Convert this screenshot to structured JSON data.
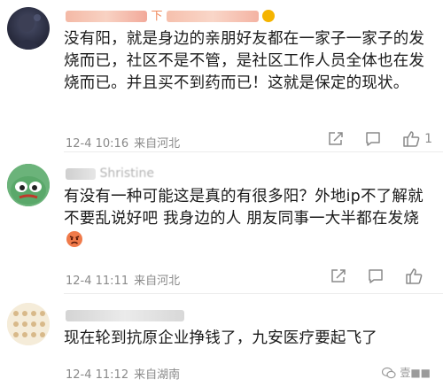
{
  "comments": [
    {
      "author": "■■■■■■■■下■■■■■■■■■5m",
      "text": "没有阳，就是身边的亲朋好友都在一家子一家子的发烧而已，社区不是不管，是社区工作人员全体也在发烧而已。并且买不到药而已！这就是保定的现状。",
      "time": "12-4 10:16",
      "source": "来自河北",
      "likes": "1"
    },
    {
      "author": "■■■■Shristine",
      "text": "有没有一种可能这是真的有很多阳？外地ip不了解就不要乱说好吧 我身边的人 朋友同事一大半都在发烧",
      "time": "12-4 11:11",
      "source": "来自河北",
      "likes": ""
    },
    {
      "author": "■■■■■■■■■■■_■■■",
      "text": "现在轮到抗原企业挣钱了，九安医疗要起飞了",
      "time": "12-4 11:12",
      "source": "来自湖南",
      "likes": ""
    }
  ],
  "watermark": {
    "text": "壹■■",
    "icon": "wechat-icon"
  },
  "icons": {
    "share": "share-icon",
    "comment": "comment-icon",
    "like": "thumbs-up-icon"
  }
}
